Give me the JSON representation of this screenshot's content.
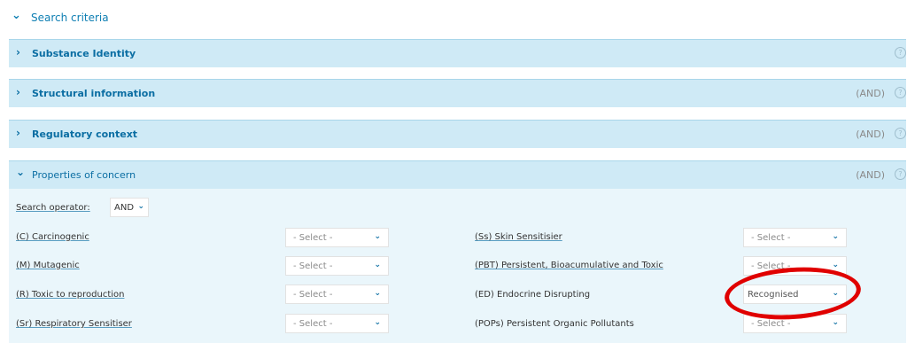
{
  "search_criteria": "Search criteria",
  "panels": {
    "substance_identity": {
      "title": "Substance Identity",
      "and": ""
    },
    "structural_information": {
      "title": "Structural information",
      "and": "(AND)"
    },
    "regulatory_context": {
      "title": "Regulatory context",
      "and": "(AND)"
    },
    "properties_of_concern": {
      "title": "Properties of concern",
      "and": "(AND)"
    }
  },
  "help": "?",
  "search_operator": {
    "label": "Search operator:",
    "value": "AND"
  },
  "left_props": [
    {
      "label": "(C) Carcinogenic",
      "value": "- Select -"
    },
    {
      "label": "(M) Mutagenic",
      "value": "- Select -"
    },
    {
      "label": "(R) Toxic to reproduction",
      "value": "- Select -"
    },
    {
      "label": "(Sr) Respiratory Sensitiser",
      "value": "- Select -"
    }
  ],
  "right_props": [
    {
      "label": "(Ss) Skin Sensitisier",
      "value": "- Select -"
    },
    {
      "label": "(PBT) Persistent, Bioacumulative and Toxic",
      "value": "- Select -"
    },
    {
      "label": "(ED) Endocrine Disrupting",
      "value": "Recognised"
    },
    {
      "label": "(POPs) Persistent Organic Pollutants",
      "value": "- Select -"
    }
  ],
  "icons": {
    "collapse": "chevron-down-icon",
    "expand": "chevron-right-icon",
    "help": "help-circle-icon",
    "dropdown": "chevron-down-icon"
  },
  "colors": {
    "panel_bg": "#cfeaf6",
    "panel_text": "#0b6ea3",
    "highlight_ring": "#e00000"
  }
}
